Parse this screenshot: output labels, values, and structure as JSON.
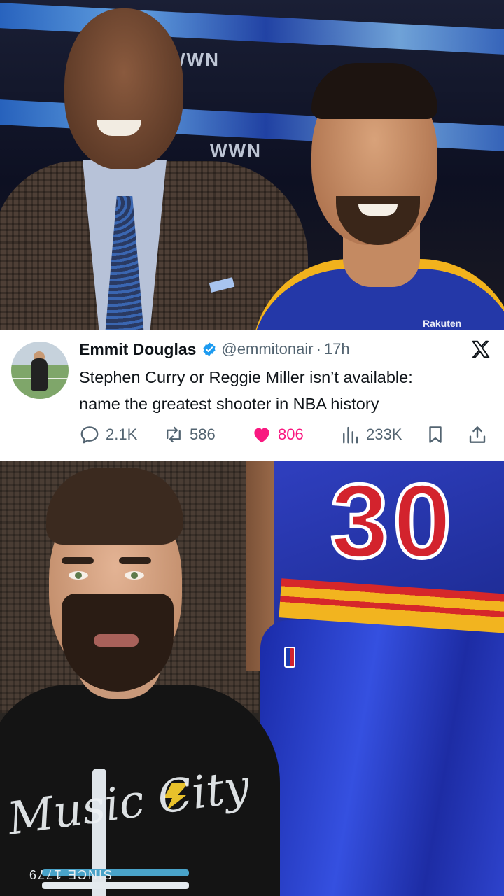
{
  "top_photo": {
    "band_texts": [
      "WWN",
      "WWN"
    ],
    "sponsor_text": "Rakuten"
  },
  "tweet": {
    "display_name": "Emmit Douglas",
    "handle": "@emmitonair",
    "separator": "·",
    "time": "17h",
    "text_line1": "Stephen Curry or Reggie Miller isn’t available:",
    "text_line2": "name the greatest shooter in NBA history",
    "replies": "2.1K",
    "reposts": "586",
    "likes": "806",
    "views": "233K",
    "colors": {
      "like": "#f91880",
      "verified": "#1d9bf0",
      "muted": "#536471",
      "text": "#0f1419"
    },
    "icons": [
      "verified-badge-icon",
      "x-logo-icon",
      "reply-icon",
      "repost-icon",
      "like-heart-icon",
      "views-chart-icon",
      "bookmark-icon",
      "share-icon"
    ]
  },
  "bottom_photo": {
    "jersey_number": "30",
    "shirt_script": "Music City",
    "shirt_since": "SINCE 1779"
  }
}
